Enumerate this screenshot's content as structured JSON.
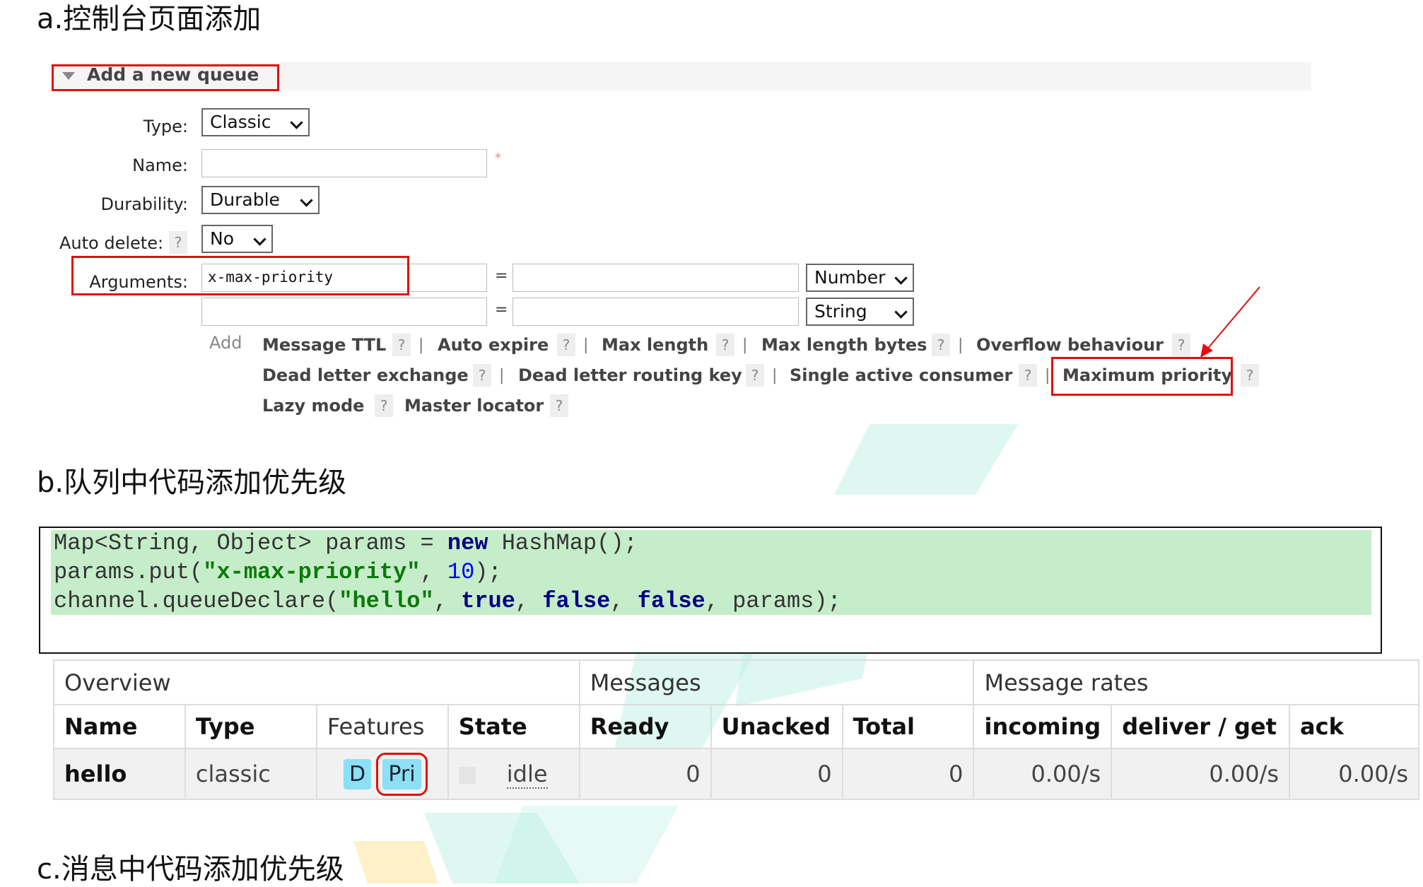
{
  "section_a": {
    "heading": "a.控制台页面添加"
  },
  "add_queue": {
    "title": "Add a new queue",
    "type_label": "Type:",
    "type_value": "Classic",
    "name_label": "Name:",
    "name_required": "*",
    "durability_label": "Durability:",
    "durability_value": "Durable",
    "auto_delete_label": "Auto delete:",
    "auto_delete_help": "?",
    "auto_delete_value": "No",
    "arguments_label": "Arguments:",
    "arguments": [
      {
        "key": "x-max-priority",
        "value": "",
        "type": "Number"
      },
      {
        "key": "",
        "value": "",
        "type": "String"
      }
    ],
    "equals": "=",
    "add_label": "Add",
    "help_items": [
      "Message TTL",
      "Auto expire",
      "Max length",
      "Max length bytes",
      "Overflow behaviour",
      "Dead letter exchange",
      "Dead letter routing key",
      "Single active consumer",
      "Maximum priority",
      "Lazy mode",
      "Master locator"
    ],
    "help_q": "?",
    "separator": "|"
  },
  "section_b": {
    "heading": "b.队列中代码添加优先级"
  },
  "code": {
    "line1_a": "Map<String, Object> params = ",
    "line1_kw": "new",
    "line1_b": " HashMap();",
    "line2_a": "params.put(",
    "line2_str": "\"x-max-priority\"",
    "line2_b": ", ",
    "line2_num": "10",
    "line2_c": ");",
    "line3_a": "channel.queueDeclare(",
    "line3_str": "\"hello\"",
    "line3_b": ", ",
    "line3_kw1": "true",
    "line3_c": ", ",
    "line3_kw2": "false",
    "line3_d": ", ",
    "line3_kw3": "false",
    "line3_e": ", params);"
  },
  "queue_table": {
    "groups": [
      "Overview",
      "Messages",
      "Message rates"
    ],
    "columns": [
      "Name",
      "Type",
      "Features",
      "State",
      "Ready",
      "Unacked",
      "Total",
      "incoming",
      "deliver / get",
      "ack"
    ],
    "row": {
      "name": "hello",
      "type": "classic",
      "feature_d": "D",
      "feature_pri": "Pri",
      "state": "idle",
      "ready": "0",
      "unacked": "0",
      "total": "0",
      "incoming": "0.00/s",
      "deliver_get": "0.00/s",
      "ack": "0.00/s"
    }
  },
  "section_c": {
    "heading": "c.消息中代码添加优先级"
  },
  "colors": {
    "highlight_red": "#e01010",
    "code_bg": "#c6edc9",
    "badge": "#8ce0f5"
  }
}
